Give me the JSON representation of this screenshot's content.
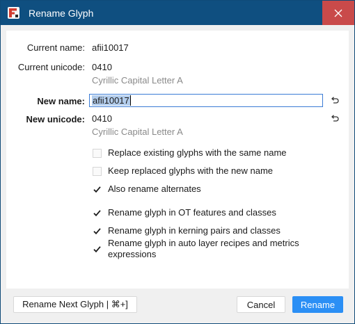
{
  "window": {
    "title": "Rename Glyph",
    "icon": "fontlab-app-icon",
    "close_icon": "close-icon"
  },
  "current": {
    "name_label": "Current name:",
    "name_value": "afii10017",
    "unicode_label": "Current unicode:",
    "unicode_value": "0410",
    "unicode_description": "Cyrillic Capital Letter A"
  },
  "new": {
    "name_label": "New name:",
    "name_value": "afii10017",
    "unicode_label": "New unicode:",
    "unicode_value": "0410",
    "unicode_description": "Cyrillic Capital Letter A",
    "reset_icon": "undo-icon"
  },
  "options": [
    {
      "label": "Replace existing glyphs with the same name",
      "checked": false
    },
    {
      "label": "Keep replaced glyphs with the new name",
      "checked": false
    },
    {
      "label": "Also rename alternates",
      "checked": true
    },
    {
      "label": "Rename glyph in OT features and classes",
      "checked": true
    },
    {
      "label": "Rename glyph in kerning pairs and classes",
      "checked": true
    },
    {
      "label": "Rename glyph in auto layer recipes and metrics expressions",
      "checked": true
    }
  ],
  "footer": {
    "rename_next_label": "Rename Next Glyph | ⌘+]",
    "cancel_label": "Cancel",
    "rename_label": "Rename"
  },
  "colors": {
    "titlebar": "#0f4f80",
    "close_hover": "#c94a4a",
    "primary": "#2b8ff5",
    "selection": "#b3cdec"
  }
}
